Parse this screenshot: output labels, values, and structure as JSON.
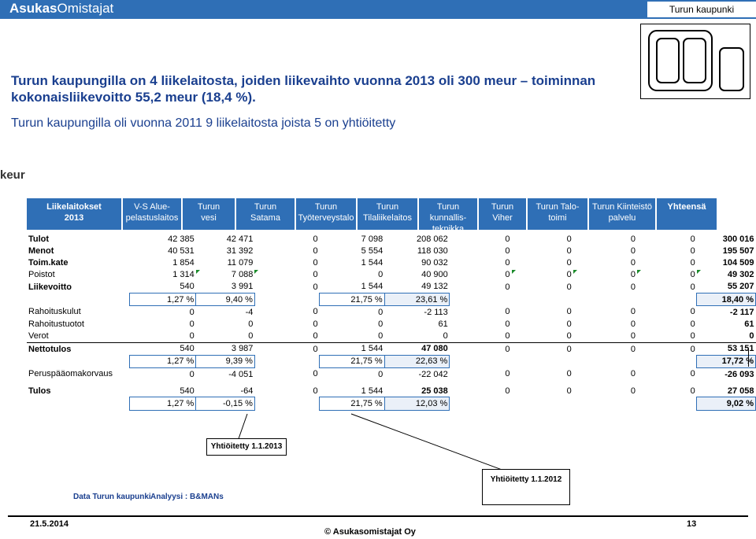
{
  "brand": {
    "part1": "Asukas",
    "part2": "Omistajat"
  },
  "org": "Turun kaupunki",
  "title": "Turun kaupungilla on 4 liikelaitosta, joiden liikevaihto vuonna 2013 oli 300 meur – toiminnan kokonaisliikevoitto 55,2 meur (18,4 %).",
  "subtitle": "Turun kaupungilla oli vuonna 2011 9 liikelaitosta joista 5 on yhtiöitetty",
  "unit": "keur",
  "headers": [
    {
      "l1": "Liikelaitokset",
      "l2": "2013"
    },
    {
      "l1": "V-S Alue-",
      "l2": "pelastuslaitos"
    },
    {
      "l1": "Turun",
      "l2": "vesi"
    },
    {
      "l1": "Turun",
      "l2": "Satama"
    },
    {
      "l1": "Turun",
      "l2": "Työterveystalo"
    },
    {
      "l1": "Turun",
      "l2": "Tilaliikelaitos"
    },
    {
      "l1": "Turun kunnallis-",
      "l2": "teknikka"
    },
    {
      "l1": "Turun",
      "l2": "Viher"
    },
    {
      "l1": "Turun Talo-",
      "l2": "toimi"
    },
    {
      "l1": "Turun Kiinteistö",
      "l2": "palvelu"
    },
    {
      "l1": "Yhteensä",
      "l2": ""
    }
  ],
  "rows": [
    {
      "label": "Tulot",
      "v": [
        "42 385",
        "42 471",
        "0",
        "7 098",
        "208 062",
        "0",
        "0",
        "0",
        "0",
        "300 016"
      ]
    },
    {
      "label": "Menot",
      "v": [
        "40 531",
        "31 392",
        "0",
        "5 554",
        "118 030",
        "0",
        "0",
        "0",
        "0",
        "195 507"
      ]
    },
    {
      "label": "Toim.kate",
      "v": [
        "1 854",
        "11 079",
        "0",
        "1 544",
        "90 032",
        "0",
        "0",
        "0",
        "0",
        "104 509"
      ]
    },
    {
      "label": "Poistot",
      "v": [
        "1 314",
        "7 088",
        "0",
        "0",
        "40 900",
        "0",
        "0",
        "0",
        "0",
        "49 302"
      ]
    },
    {
      "label": "Liikevoitto",
      "v": [
        "540",
        "3 991",
        "0",
        "1 544",
        "49 132",
        "0",
        "0",
        "0",
        "0",
        "55 207"
      ]
    },
    {
      "label": "",
      "v": [
        "1,27 %",
        "9,40 %",
        "",
        "21,75 %",
        "23,61 %",
        "",
        "",
        "",
        "",
        "18,40 %"
      ]
    },
    {
      "label": "Rahoituskulut",
      "v": [
        "0",
        "-4",
        "0",
        "0",
        "-2 113",
        "0",
        "0",
        "0",
        "0",
        "-2 117"
      ]
    },
    {
      "label": "Rahoitustuotot",
      "v": [
        "0",
        "0",
        "0",
        "0",
        "61",
        "0",
        "0",
        "0",
        "0",
        "61"
      ]
    },
    {
      "label": "Verot",
      "v": [
        "0",
        "0",
        "0",
        "0",
        "0",
        "0",
        "0",
        "0",
        "0",
        "0"
      ]
    },
    {
      "label": "Nettotulos",
      "v": [
        "540",
        "3 987",
        "0",
        "1 544",
        "47 080",
        "0",
        "0",
        "0",
        "0",
        "53 151"
      ]
    },
    {
      "label": "",
      "v": [
        "1,27 %",
        "9,39 %",
        "",
        "21,75 %",
        "22,63 %",
        "",
        "",
        "",
        "",
        "17,72 %"
      ]
    },
    {
      "label": "Peruspääomakorvaus",
      "v": [
        "0",
        "-4 051",
        "0",
        "0",
        "-22 042",
        "0",
        "0",
        "0",
        "0",
        "-26 093"
      ]
    },
    {
      "label": "Tulos",
      "v": [
        "540",
        "-64",
        "0",
        "1 544",
        "25 038",
        "0",
        "0",
        "0",
        "0",
        "27 058"
      ]
    },
    {
      "label": "",
      "v": [
        "1,27 %",
        "-0,15 %",
        "",
        "21,75 %",
        "12,03 %",
        "",
        "",
        "",
        "",
        "9,02 %"
      ]
    }
  ],
  "callouts": {
    "first": "Yhtiöitetty 1.1.2013",
    "second": "Yhtiöitetty 1.1.2012"
  },
  "footer": {
    "data_source": "Data Turun kaupunki",
    "analysis": "Analyysi : B&MANs",
    "date": "21.5.2014",
    "page": "13",
    "copyright": "© Asukasomistajat Oy"
  },
  "colors": {
    "header_blue": "#2f6fb6",
    "title_navy": "#1a3f8f",
    "marker_green": "#1a8a2a"
  }
}
